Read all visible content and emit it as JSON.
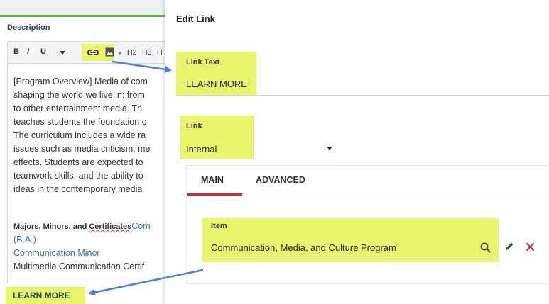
{
  "left": {
    "description_label": "Description",
    "toolbar": {
      "bold": "B",
      "italic": "I",
      "underline": "U",
      "h2": "H2",
      "h3": "H3",
      "h_partial": "H"
    },
    "body_lines": [
      "[Program Overview] Media of com",
      "shaping the world we live in: from",
      "to other entertainment media. Th",
      "teaches students the foundation c",
      "The curriculum includes a wide ra",
      "issues such as media criticism, me",
      "effects. Students are expected to",
      "teamwork skills, and the ability to",
      "ideas in the contemporary media"
    ],
    "majors_label": "Majors, Minors, and ",
    "majors_label_underlined": "Certificates",
    "majors_link_start": "Com",
    "link_ba": "(B.A.)",
    "link_minor": "Communication Minor",
    "multimedia": "Multimedia Communication Certif",
    "learn_more_button": "LEARN MORE"
  },
  "dialog": {
    "title": "Edit Link",
    "link_text_label": "Link Text",
    "link_text_value": "LEARN MORE",
    "link_label": "Link",
    "link_value": "Internal",
    "tabs": [
      "MAIN",
      "ADVANCED"
    ],
    "item_label": "Item",
    "item_value": "Communication, Media, and Culture Program"
  },
  "colors": {
    "highlight": "#e9f56b",
    "tab_active_underline": "#c9302c",
    "link_blue": "#3b6fb5",
    "arrow_blue": "#4a7fe0",
    "delete_red": "#d0312d"
  },
  "icons": [
    "dropdown-caret-icon",
    "link-icon",
    "image-icon",
    "search-icon",
    "pencil-icon",
    "close-icon"
  ]
}
